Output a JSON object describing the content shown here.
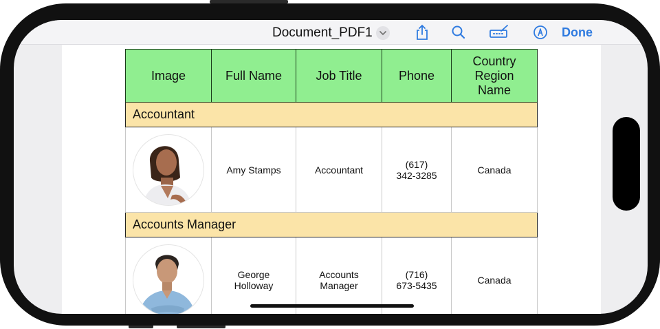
{
  "navbar": {
    "title": "Document_PDF1",
    "title_menu_icon": "chevron-down-icon",
    "actions": [
      {
        "name": "share",
        "icon": "share-icon"
      },
      {
        "name": "search",
        "icon": "search-icon"
      },
      {
        "name": "sign",
        "icon": "signature-icon"
      },
      {
        "name": "markup",
        "icon": "markup-pen-icon"
      }
    ],
    "done_label": "Done"
  },
  "colors": {
    "accent": "#2f7be0",
    "header_bg": "#90ee90",
    "group_bg": "#fbe4a8"
  },
  "table": {
    "headers": [
      "Image",
      "Full Name",
      "Job Title",
      "Phone",
      "Country Region Name"
    ],
    "groups": [
      {
        "label": "Accountant",
        "rows": [
          {
            "image": "avatar-woman",
            "full_name": "Amy Stamps",
            "job_title": "Accountant",
            "phone": "(617) 342-3285",
            "country": "Canada"
          }
        ]
      },
      {
        "label": "Accounts Manager",
        "rows": [
          {
            "image": "avatar-man",
            "full_name": "George Holloway",
            "job_title": "Accounts Manager",
            "phone": "(716) 673-5435",
            "country": "Canada"
          }
        ]
      }
    ]
  }
}
